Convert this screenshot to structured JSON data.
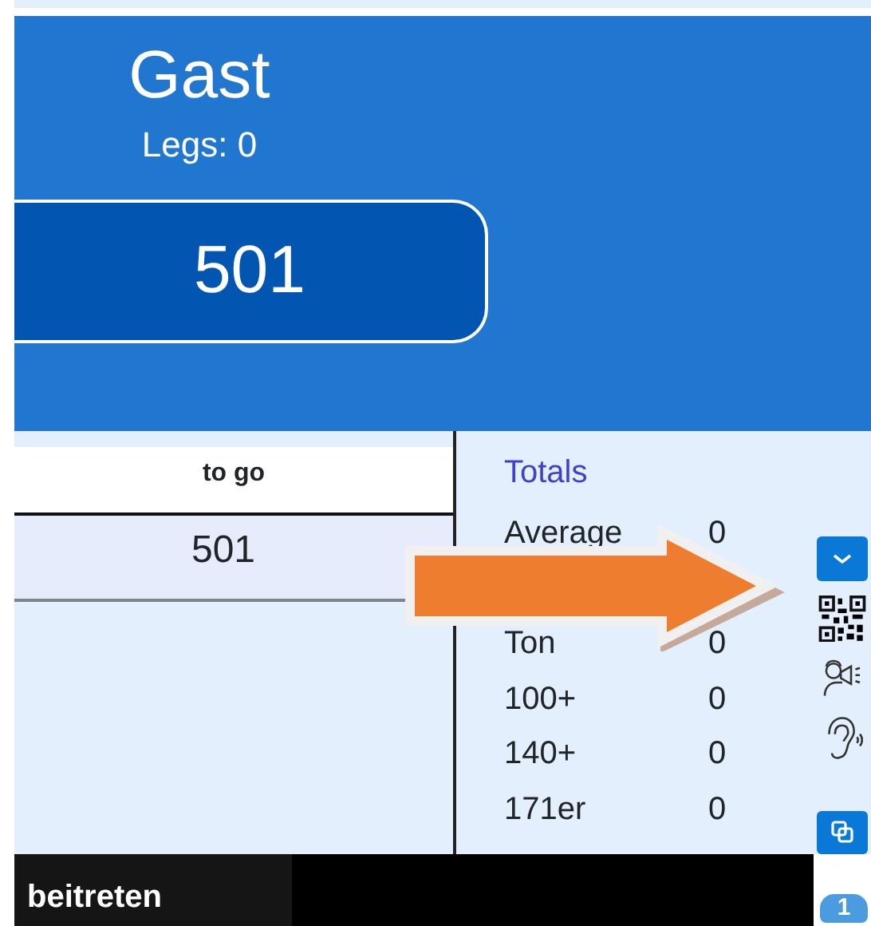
{
  "player": {
    "name": "Gast",
    "legs": "Legs: 0",
    "score": "501"
  },
  "table": {
    "columns": [
      "to go"
    ],
    "rows": [
      [
        "501"
      ]
    ]
  },
  "totals": {
    "title": "Totals",
    "rows": [
      {
        "label": "Average",
        "value": "0"
      },
      {
        "label": "Ton",
        "value": "0"
      },
      {
        "label": "100+",
        "value": "0"
      },
      {
        "label": "140+",
        "value": "0"
      },
      {
        "label": "171er",
        "value": "0"
      }
    ]
  },
  "side_badge": "1",
  "bottom_bar": {
    "label": "beitreten"
  }
}
